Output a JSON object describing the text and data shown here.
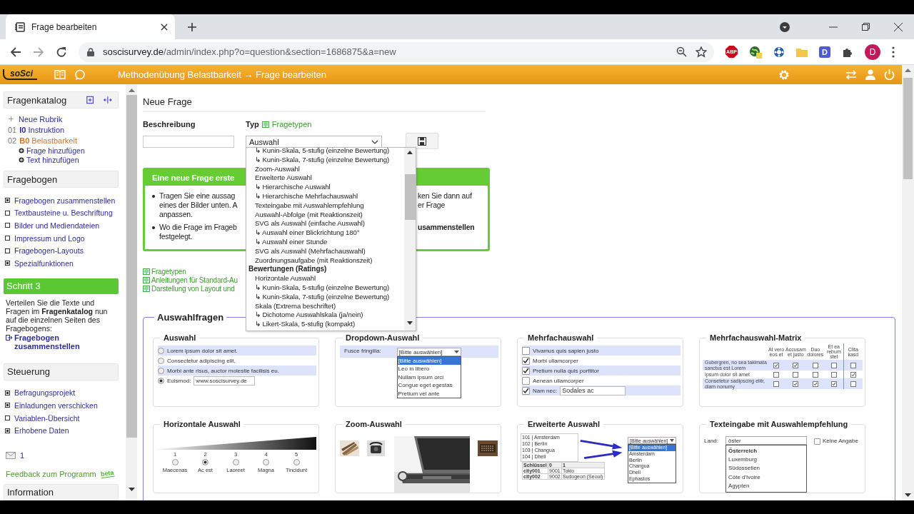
{
  "browser": {
    "tab_title": "Frage bearbeiten",
    "url_host": "soscisurvey.de",
    "url_path": "/admin/index.php?o=question&section=1686875&a=new",
    "extensions": [
      {
        "kind": "abp",
        "label": "ABP"
      },
      {
        "kind": "globe"
      },
      {
        "kind": "wheel"
      },
      {
        "kind": "folder"
      },
      {
        "kind": "letter",
        "label": "D"
      },
      {
        "kind": "puzzle"
      }
    ],
    "profile_initial": "D"
  },
  "app_header": {
    "logo": "soSci",
    "breadcrumb": "Methodenübung Belastbarkeit → Frage bearbeiten"
  },
  "sidebar": {
    "catalog": {
      "title": "Fragenkatalog",
      "new_section": "Neue Rubrik",
      "sections": [
        {
          "number": "01",
          "code": "I0",
          "name": "Instruktion",
          "selected": false
        },
        {
          "number": "02",
          "code": "B0",
          "name": "Belastbarkeit",
          "selected": true,
          "actions": [
            "Frage hinzufügen",
            "Text hinzufügen"
          ]
        }
      ]
    },
    "questionnaire": {
      "title": "Fragebogen",
      "items": [
        {
          "label": "Fragebogen zusammenstellen",
          "expandable": true
        },
        {
          "label": "Textbausteine u. Beschriftung",
          "expandable": false
        },
        {
          "label": "Bilder und Mediendateien",
          "expandable": false
        },
        {
          "label": "Impressum und Logo",
          "expandable": false
        },
        {
          "label": "Fragebogen-Layouts",
          "expandable": false
        },
        {
          "label": "Spezialfunktionen",
          "expandable": true
        }
      ]
    },
    "step": {
      "title": "Schritt 3",
      "text": "Verteilen Sie die Texte und Fragen im **Fragenkatalog** nun auf die einzelnen Seiten des Fragebogens:",
      "link": "Fragebogen zusammenstellen"
    },
    "control": {
      "title": "Steuerung",
      "items": [
        {
          "label": "Befragungsprojekt",
          "expandable": true
        },
        {
          "label": "Einladungen verschicken",
          "expandable": true
        },
        {
          "label": "Variablen-Übersicht",
          "expandable": false
        },
        {
          "label": "Erhobene Daten",
          "expandable": true
        }
      ]
    },
    "messages_count": "1",
    "feedback": "Feedback zum Programm",
    "beta": "beta",
    "information_title": "Information"
  },
  "main": {
    "heading": "Neue Frage",
    "description_label": "Beschreibung",
    "type_label": "Typ",
    "type_help": "Fragetypen",
    "type_value": "Auswahl",
    "type_options": [
      {
        "kind": "option",
        "label": "↳ Kunin-Skala, 5-stufig (einzelne Bewertung)"
      },
      {
        "kind": "option",
        "label": "↳ Kunin-Skala, 7-stufig (einzelne Bewertung)"
      },
      {
        "kind": "option",
        "label": "Zoom-Auswahl"
      },
      {
        "kind": "option",
        "label": "Erweiterte Auswahl"
      },
      {
        "kind": "option",
        "label": "↳ Hierarchische Auswahl"
      },
      {
        "kind": "option",
        "label": "↳ Hierarchische Mehrfachauswahl"
      },
      {
        "kind": "option",
        "label": "Texteingabe mit Auswahlempfehlung"
      },
      {
        "kind": "option",
        "label": "Auswahl-Abfolge (mit Reaktionszeit)"
      },
      {
        "kind": "option",
        "label": "SVG als Auswahl (einfache Auswahl)"
      },
      {
        "kind": "option",
        "label": "↳ Auswahl einer Blickrichtung 180°"
      },
      {
        "kind": "option",
        "label": "↳ Auswahl einer Stunde"
      },
      {
        "kind": "option",
        "label": "SVG als Auswahl (Mehrfachauswahl)"
      },
      {
        "kind": "option",
        "label": "Zuordnungsaufgabe (mit Reaktionszeit)"
      },
      {
        "kind": "group",
        "label": "Bewertungen (Ratings)"
      },
      {
        "kind": "option",
        "label": "Horizontale Auswahl"
      },
      {
        "kind": "option",
        "label": "↳ Kunin-Skala, 5-stufig (einzelne Bewertung)"
      },
      {
        "kind": "option",
        "label": "↳ Kunin-Skala, 7-stufig (einzelne Bewertung)"
      },
      {
        "kind": "option",
        "label": "Skala (Extrema beschriftet)"
      },
      {
        "kind": "option",
        "label": "↳ Dichotome Auswahlskala (ja/nein)"
      },
      {
        "kind": "option",
        "label": "↳ Likert-Skala, 5-stufig (kompakt)"
      }
    ],
    "info_box": {
      "title": "Eine neue Frage erste",
      "bullets": [
        {
          "left": "Tragen Sie eine aussag\neines der Bilder unten. A\nanpassen.",
          "right": "ken Sie dann auf\ner Frage"
        },
        {
          "left": "Wo die Frage im Frageb\nfestgelegt.",
          "right": "usammenstellen"
        }
      ]
    },
    "help_links": [
      "Fragetypen",
      "Anleitungen für Standard-Au",
      "Darstellung von Layout und"
    ],
    "section": {
      "title": "Auswahlfragen",
      "cards": [
        {
          "kind": "radio",
          "title": "Auswahl",
          "options": [
            {
              "label": "Lorem ipsum dolor sit amet.",
              "selected": false
            },
            {
              "label": "Consectetur adipiscing elit.",
              "selected": false
            },
            {
              "label": "Morbi ante risus, auctor molestie facilisis eu.",
              "selected": false
            },
            {
              "label": "Euismod:",
              "selected": true,
              "field_value": "www.soscisurvey.de"
            }
          ]
        },
        {
          "kind": "dropdown",
          "title": "Dropdown-Auswahl",
          "label": "Fusce fringilla:",
          "value": "[Bitte auswählen]",
          "options": [
            {
              "label": "[Bitte auswählen]",
              "selected": true
            },
            {
              "label": "Leo in libero",
              "selected": false
            },
            {
              "label": "Nullam ipsum orci",
              "selected": false
            },
            {
              "label": "Congue eget egestas",
              "selected": false
            },
            {
              "label": "Pretium vel ante",
              "selected": false
            }
          ]
        },
        {
          "kind": "checkbox",
          "title": "Mehrfachauswahl",
          "options": [
            {
              "label": "Vivamus quis sapien justo",
              "checked": false
            },
            {
              "label": "Morbi ullamcorper",
              "checked": true
            },
            {
              "label": "Pretium nulla quis porttitor",
              "checked": true
            },
            {
              "label": "Aenean ullamcorper",
              "checked": false
            },
            {
              "label": "Nam nec:",
              "checked": true,
              "field_value": "Sodales ac"
            }
          ]
        },
        {
          "kind": "matrix",
          "title": "Mehrfachauswahl-Matrix",
          "columns": [
            "At vero eos et",
            "Accusam et justo",
            "Duo dolores",
            "Et ea rebum stet",
            "Clita kasd"
          ],
          "rows": [
            {
              "label": "Gubergren, no sea takimata sanctus est Lorem",
              "checks": [
                true,
                true,
                false,
                false,
                false
              ]
            },
            {
              "label": "Ipsum dolor sit amet",
              "checks": [
                false,
                false,
                false,
                false,
                true
              ]
            },
            {
              "label": "Consetetur sadipscing elitr, diam nonumy",
              "checks": [
                false,
                true,
                true,
                true,
                false
              ]
            }
          ]
        },
        {
          "kind": "scale",
          "title": "Horizontale Auswahl",
          "points": [
            {
              "number": "1",
              "label": "Maecenas",
              "selected": false
            },
            {
              "number": "2",
              "label": "Ac est",
              "selected": true
            },
            {
              "number": "3",
              "label": "Laoreet",
              "selected": false
            },
            {
              "number": "4",
              "label": "Magna",
              "selected": false
            },
            {
              "number": "5",
              "label": "Tincidunt",
              "selected": false
            }
          ]
        },
        {
          "kind": "zoom",
          "title": "Zoom-Auswahl"
        },
        {
          "kind": "extended",
          "title": "Erweiterte Auswahl",
          "list": [
            "101 | Amsterdam",
            "102 | Berlin",
            "103 | Changua",
            "104 | Dheli"
          ],
          "table_header": [
            "Schlüssel",
            "0",
            "1"
          ],
          "table_rows": [
            [
              "city001",
              "9001",
              "Tokio"
            ],
            [
              "city002",
              "9002",
              "Sudogeon (Seoul)"
            ]
          ],
          "value": "[Bitte auswählen]",
          "options": [
            {
              "label": "[Bitte auswählen]",
              "selected": true
            },
            {
              "label": "Amsterdam",
              "selected": false
            },
            {
              "label": "Berlin",
              "selected": false
            },
            {
              "label": "Changua",
              "selected": false
            },
            {
              "label": "Dheli",
              "selected": false
            },
            {
              "label": "Ephastos",
              "selected": false
            }
          ]
        },
        {
          "kind": "suggest",
          "title": "Texteingabe mit Auswahlempfehlung",
          "label": "Land:",
          "value": "öster",
          "checkbox_label": "Keine Angabe",
          "checked": false,
          "suggestions": [
            {
              "label": "Österreich",
              "selected": true
            },
            {
              "label": "Luxemburg",
              "selected": false
            },
            {
              "label": "Südossetien",
              "selected": false
            },
            {
              "label": "Côte d'Ivoire",
              "selected": false
            },
            {
              "label": "Ägypten",
              "selected": false
            }
          ]
        }
      ]
    }
  }
}
